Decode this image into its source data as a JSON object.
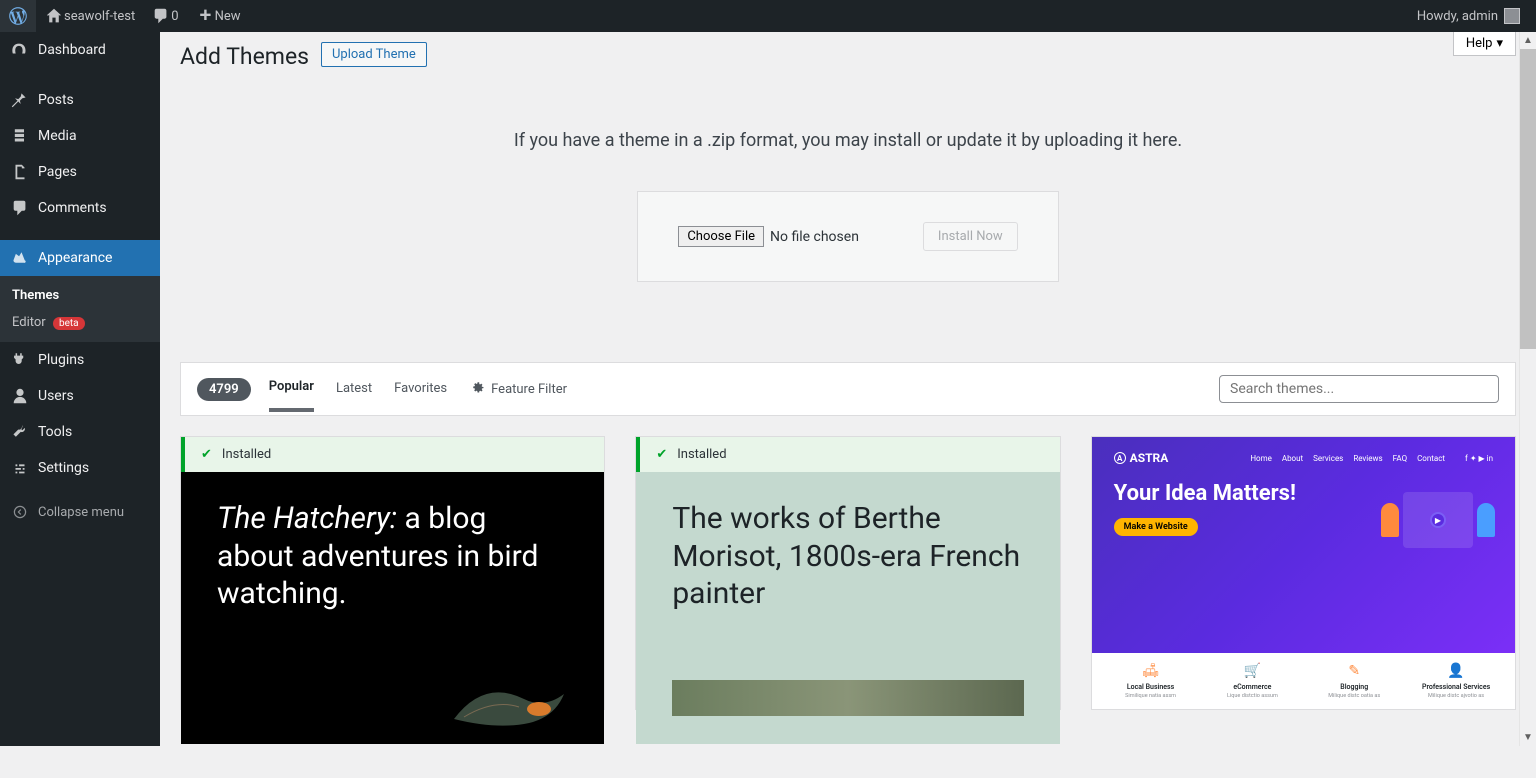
{
  "adminbar": {
    "site_name": "seawolf-test",
    "comments_count": "0",
    "new_label": "New",
    "howdy": "Howdy, admin"
  },
  "sidebar": {
    "items": [
      {
        "label": "Dashboard"
      },
      {
        "label": "Posts"
      },
      {
        "label": "Media"
      },
      {
        "label": "Pages"
      },
      {
        "label": "Comments"
      },
      {
        "label": "Appearance"
      },
      {
        "label": "Plugins"
      },
      {
        "label": "Users"
      },
      {
        "label": "Tools"
      },
      {
        "label": "Settings"
      }
    ],
    "submenu": {
      "themes": "Themes",
      "editor": "Editor",
      "editor_badge": "beta"
    },
    "collapse": "Collapse menu"
  },
  "help_label": "Help",
  "page": {
    "title": "Add Themes",
    "upload_button": "Upload Theme",
    "upload_message": "If you have a theme in a .zip format, you may install or update it by uploading it here.",
    "choose_file": "Choose File",
    "no_file": "No file chosen",
    "install_now": "Install Now"
  },
  "filter": {
    "count": "4799",
    "tabs": {
      "popular": "Popular",
      "latest": "Latest",
      "favorites": "Favorites"
    },
    "feature_filter": "Feature Filter",
    "search_placeholder": "Search themes..."
  },
  "themes": [
    {
      "installed": true,
      "installed_label": "Installed",
      "preview": {
        "kind": "tt3",
        "headline_italic": "The Hatchery:",
        "headline_rest": " a blog about adventures in bird watching."
      }
    },
    {
      "installed": true,
      "installed_label": "Installed",
      "preview": {
        "kind": "tt1",
        "headline": "The works of Berthe Morisot, 1800s-era French painter"
      }
    },
    {
      "installed": false,
      "preview": {
        "kind": "astra",
        "logo": "ASTRA",
        "nav": [
          "Home",
          "About",
          "Services",
          "Reviews",
          "FAQ",
          "Contact"
        ],
        "headline": "Your Idea Matters!",
        "cta": "Make a Website",
        "features": [
          {
            "icon": "🛋",
            "label": "Local Business",
            "sub": "Similique natia assm"
          },
          {
            "icon": "🛒",
            "label": "eCommerce",
            "sub": "Lique distctio assum"
          },
          {
            "icon": "✎",
            "label": "Blogging",
            "sub": "Milique distc oatia as"
          },
          {
            "icon": "👤",
            "label": "Professional Services",
            "sub": "Milique distc ajvotio as"
          }
        ]
      }
    }
  ]
}
